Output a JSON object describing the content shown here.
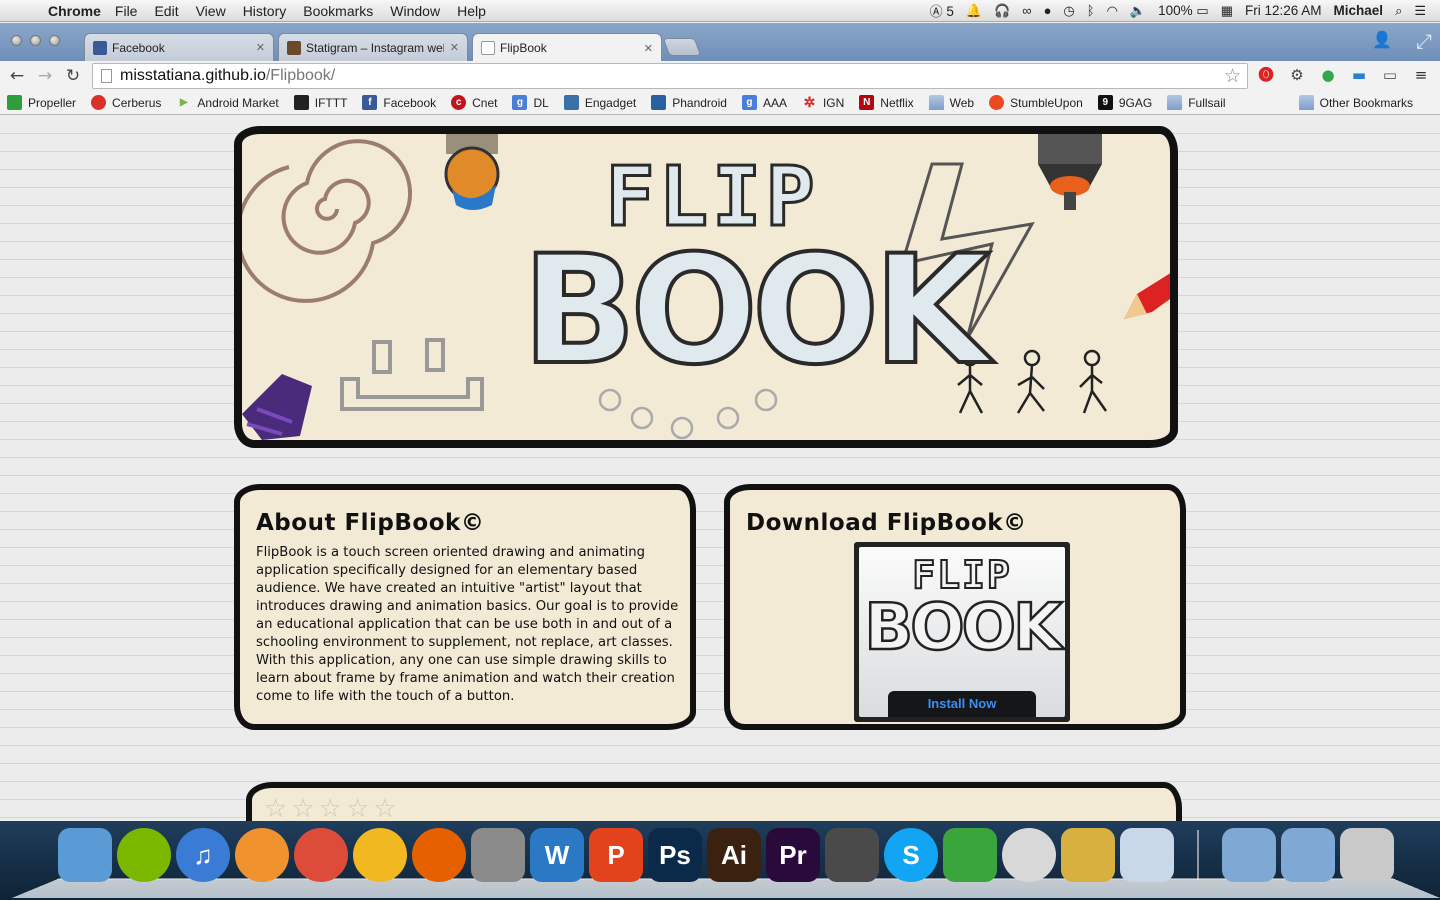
{
  "menubar": {
    "app_name": "Chrome",
    "menus": [
      "File",
      "Edit",
      "View",
      "History",
      "Bookmarks",
      "Window",
      "Help"
    ],
    "adobe_badge": "5",
    "battery": "100%",
    "clock": "Fri 12:26 AM",
    "user": "Michael"
  },
  "tabs": [
    {
      "title": "Facebook",
      "favicon_color": "#3b5998",
      "active": false
    },
    {
      "title": "Statigram – Instagram web",
      "favicon_color": "#6b4a2b",
      "active": false
    },
    {
      "title": "FlipBook",
      "favicon_color": "#ffffff",
      "active": true
    }
  ],
  "toolbar": {
    "url_host": "misstatiana.github.io",
    "url_path": "/Flipbook/"
  },
  "bookmarks": [
    {
      "label": "Propeller",
      "icon": "propeller-icon",
      "color": "#2e9e3c"
    },
    {
      "label": "Cerberus",
      "icon": "cerberus-icon",
      "color": "#d9302a"
    },
    {
      "label": "Android Market",
      "icon": "android-market-icon",
      "color": "#7ab648"
    },
    {
      "label": "IFTTT",
      "icon": "ifttt-icon",
      "color": "#222222"
    },
    {
      "label": "Facebook",
      "icon": "facebook-icon",
      "color": "#3b5998"
    },
    {
      "label": "Cnet",
      "icon": "cnet-icon",
      "color": "#c0141d"
    },
    {
      "label": "DL",
      "icon": "google-icon",
      "color": "#4a7fd8"
    },
    {
      "label": "Engadget",
      "icon": "engadget-icon",
      "color": "#3a6fa8"
    },
    {
      "label": "Phandroid",
      "icon": "phandroid-icon",
      "color": "#2a5fa0"
    },
    {
      "label": "AAA",
      "icon": "google-icon",
      "color": "#4a7fd8"
    },
    {
      "label": "IGN",
      "icon": "ign-icon",
      "color": "#d42a2a"
    },
    {
      "label": "Netflix",
      "icon": "netflix-icon",
      "color": "#b20710"
    },
    {
      "label": "Web",
      "icon": "folder-icon",
      "color": "folder"
    },
    {
      "label": "StumbleUpon",
      "icon": "stumbleupon-icon",
      "color": "#eb4923"
    },
    {
      "label": "9GAG",
      "icon": "9gag-icon",
      "color": "#111111"
    },
    {
      "label": "Fullsail",
      "icon": "folder-icon",
      "color": "folder"
    }
  ],
  "other_bookmarks": "Other Bookmarks",
  "page": {
    "about_heading": "About FlipBook©",
    "about_text": "FlipBook is a touch screen oriented drawing and animating application specifically designed for an elementary based audience. We have created an intuitive \"artist\" layout that introduces drawing and animation basics. Our goal is to provide an educational application that can be use both in and out of a schooling environment to supplement, not replace, art classes. With this application, any one can use simple drawing skills to learn about frame by frame animation and watch their creation come to life with the touch of a button.",
    "download_heading": "Download FlipBook©",
    "install_button": "Install Now",
    "logo_top": "FLIP",
    "logo_bottom": "BOOK"
  },
  "dock": [
    {
      "name": "finder-icon",
      "label": "",
      "color": "#5b9bd5"
    },
    {
      "name": "spotify-icon",
      "label": "",
      "color": "#7ab800"
    },
    {
      "name": "itunes-icon",
      "label": "♫",
      "color": "#3a7bd5"
    },
    {
      "name": "ibooks-icon",
      "label": "",
      "color": "#f0922e"
    },
    {
      "name": "chrome-icon",
      "label": "",
      "color": "#dd4b39"
    },
    {
      "name": "chrome-canary-icon",
      "label": "",
      "color": "#f2b821"
    },
    {
      "name": "firefox-icon",
      "label": "",
      "color": "#e66000"
    },
    {
      "name": "system-preferences-icon",
      "label": "",
      "color": "#8a8a8a"
    },
    {
      "name": "word-icon",
      "label": "W",
      "color": "#2b78c5"
    },
    {
      "name": "powerpoint-icon",
      "label": "P",
      "color": "#e3431c"
    },
    {
      "name": "photoshop-icon",
      "label": "Ps",
      "color": "#0b2a4a"
    },
    {
      "name": "illustrator-icon",
      "label": "Ai",
      "color": "#3b2210"
    },
    {
      "name": "premiere-icon",
      "label": "Pr",
      "color": "#2a0a3a"
    },
    {
      "name": "github-icon",
      "label": "",
      "color": "#4a4a4a"
    },
    {
      "name": "skype-icon",
      "label": "S",
      "color": "#12a5f4"
    },
    {
      "name": "leaf-icon",
      "label": "",
      "color": "#3aa53a"
    },
    {
      "name": "sequel-pro-icon",
      "label": "",
      "color": "#d8d8d8"
    },
    {
      "name": "database-icon",
      "label": "",
      "color": "#d8b040"
    },
    {
      "name": "preview-icon",
      "label": "",
      "color": "#c8d8e8"
    }
  ],
  "dock_right": [
    {
      "name": "applications-folder-icon",
      "color": "#7fa9d4"
    },
    {
      "name": "downloads-folder-icon",
      "color": "#7fa9d4"
    },
    {
      "name": "trash-icon",
      "color": "#c9c9c9"
    }
  ]
}
